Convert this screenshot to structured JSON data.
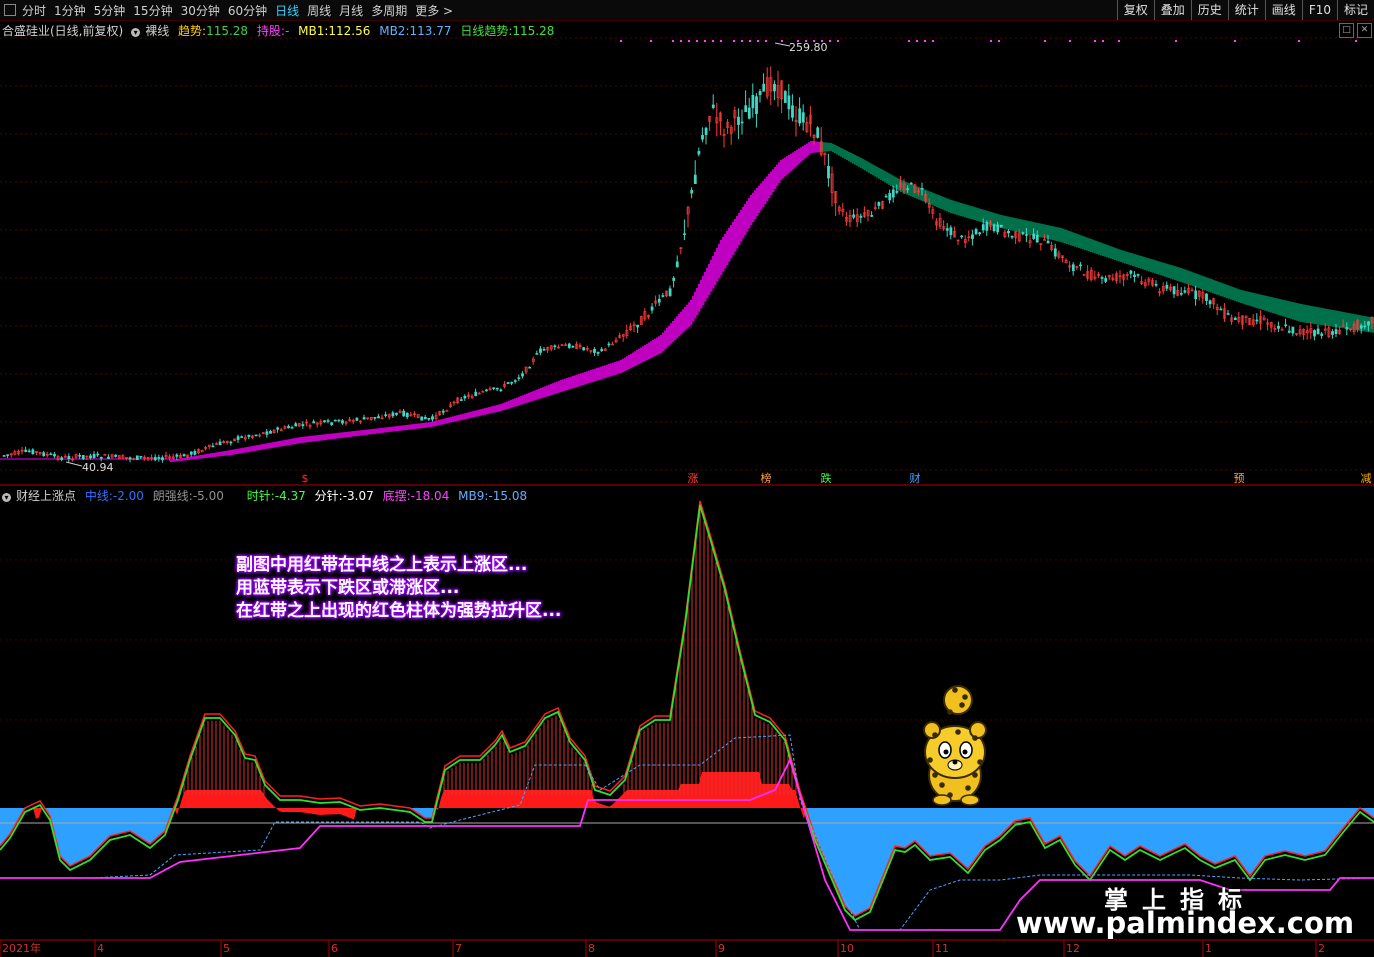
{
  "toolbar": {
    "items": [
      "分时",
      "1分钟",
      "5分钟",
      "15分钟",
      "30分钟",
      "60分钟",
      "日线",
      "周线",
      "月线",
      "多周期",
      "更多 >"
    ],
    "active_index": 6,
    "right_items": [
      "复权",
      "叠加",
      "历史",
      "统计",
      "画线",
      "F10",
      "标记"
    ]
  },
  "main_panel": {
    "stock_title": "合盛硅业(日线,前复权)",
    "style_label": "裸线",
    "trend_label": "趋势:",
    "trend_value": "115.28",
    "hold_label": "持股:",
    "hold_value": "-",
    "mb1_label": "MB1:",
    "mb1_value": "112.56",
    "mb2_label": "MB2:",
    "mb2_value": "113.77",
    "daily_trend_label": "日线趋势:",
    "daily_trend_value": "115.28",
    "high_marker": "259.80",
    "low_marker": "40.94",
    "markers": [
      {
        "text": "$",
        "color": "#ff3030"
      },
      {
        "text": "涨",
        "color": "#ff4040"
      },
      {
        "text": "榜",
        "color": "#ffa040"
      },
      {
        "text": "跌",
        "color": "#40ff40"
      },
      {
        "text": "财",
        "color": "#40a0ff"
      },
      {
        "text": "预",
        "color": "#ffa040"
      },
      {
        "text": "减",
        "color": "#ffb000"
      }
    ],
    "colors": {
      "up": "#ff3c3c",
      "down": "#3fd8c4",
      "band_up": "#c000c0",
      "band_down": "#00704a"
    }
  },
  "sub_panel": {
    "indicator_name": "财经上涨点",
    "midline_label": "中线:",
    "midline_value": "-2.00",
    "strong_label": "朗强线:",
    "strong_value": "-5.00",
    "hour_label": "时针:",
    "hour_value": "-4.37",
    "minute_label": "分针:",
    "minute_value": "-3.07",
    "bottom_label": "底摆:",
    "bottom_value": "-18.04",
    "mb9_label": "MB9:",
    "mb9_value": "-15.08",
    "annotation": [
      "副图中用红带在中线之上表示上涨区...",
      "用蓝带表示下跌区或滞涨区...",
      "在红带之上出现的红色柱体为强势拉升区..."
    ]
  },
  "date_axis": [
    "2021年",
    "4",
    "5",
    "6",
    "7",
    "8",
    "9",
    "10",
    "11",
    "12",
    "1",
    "2"
  ],
  "watermark": {
    "line1": "掌上指标",
    "line2": "www.palmindex.com"
  }
}
